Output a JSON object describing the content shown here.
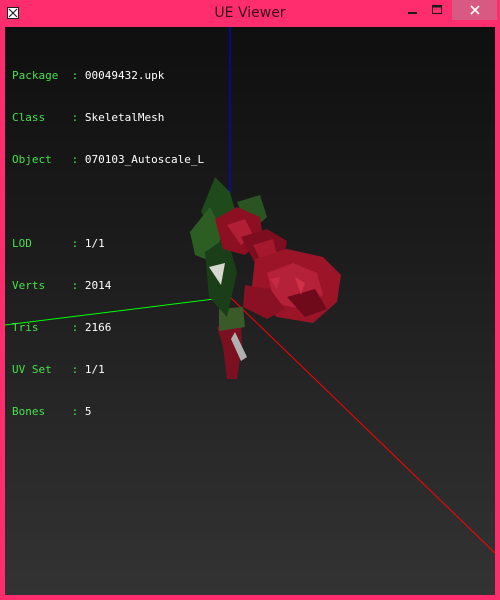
{
  "window": {
    "title": "UE Viewer"
  },
  "icons": {
    "app": "app-icon",
    "minimize": "minimize-icon",
    "maximize": "maximize-icon",
    "close": "close-icon"
  },
  "info": {
    "package": {
      "label": "Package",
      "sep": ":",
      "value": "00049432.upk"
    },
    "class": {
      "label": "Class",
      "sep": ":",
      "value": "SkeletalMesh"
    },
    "object": {
      "label": "Object",
      "sep": ":",
      "value": "070103_Autoscale_L"
    },
    "lod": {
      "label": "LOD",
      "sep": ":",
      "value": "1/1"
    },
    "verts": {
      "label": "Verts",
      "sep": ":",
      "value": "2014"
    },
    "tris": {
      "label": "Tris",
      "sep": ":",
      "value": "2166"
    },
    "uvset": {
      "label": "UV Set",
      "sep": ":",
      "value": "1/1"
    },
    "bones": {
      "label": "Bones",
      "sep": ":",
      "value": "5"
    }
  },
  "colors": {
    "frame": "#ff2c6e",
    "label_text": "#47e04a",
    "value_text": "#ffffff",
    "axis_x": "#ff0000",
    "axis_y": "#00ff00",
    "axis_z": "#0000ff",
    "petals": "#9b1428",
    "leaves": "#1f4a1c"
  }
}
